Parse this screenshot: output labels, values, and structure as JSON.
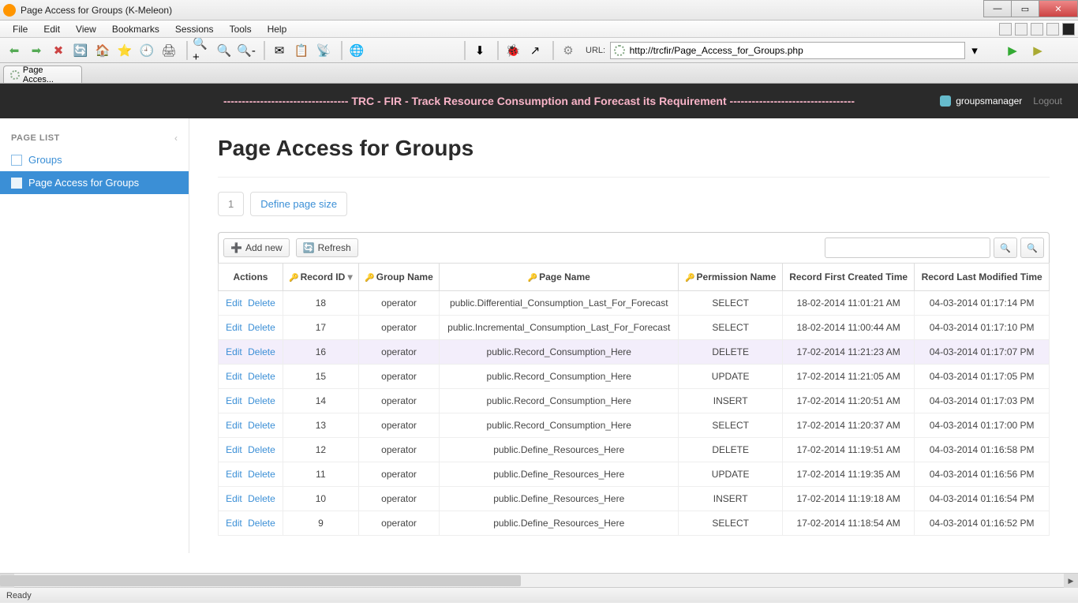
{
  "window": {
    "title": "Page Access for Groups (K-Meleon)"
  },
  "menu": [
    "File",
    "Edit",
    "View",
    "Bookmarks",
    "Sessions",
    "Tools",
    "Help"
  ],
  "url": {
    "label": "URL:",
    "value": "http://trcfir/Page_Access_for_Groups.php"
  },
  "tab": "Page Acces...",
  "banner": "---------------------------------- TRC - FIR - Track Resource Consumption and Forecast its Requirement ----------------------------------",
  "user": "groupsmanager",
  "logout": "Logout",
  "sidebar": {
    "title": "PAGE LIST",
    "items": [
      {
        "label": "Groups",
        "active": false
      },
      {
        "label": "Page Access for Groups",
        "active": true
      }
    ]
  },
  "page": {
    "title": "Page Access for Groups",
    "page_num": "1",
    "define_size": "Define page size",
    "add_new": "Add new",
    "refresh": "Refresh"
  },
  "columns": [
    "Actions",
    "Record ID",
    "Group Name",
    "Page Name",
    "Permission Name",
    "Record First Created Time",
    "Record Last Modified Time"
  ],
  "actions": {
    "edit": "Edit",
    "delete": "Delete"
  },
  "rows": [
    {
      "id": "18",
      "group": "operator",
      "page": "public.Differential_Consumption_Last_For_Forecast",
      "perm": "SELECT",
      "created": "18-02-2014 11:01:21 AM",
      "modified": "04-03-2014 01:17:14 PM"
    },
    {
      "id": "17",
      "group": "operator",
      "page": "public.Incremental_Consumption_Last_For_Forecast",
      "perm": "SELECT",
      "created": "18-02-2014 11:00:44 AM",
      "modified": "04-03-2014 01:17:10 PM"
    },
    {
      "id": "16",
      "group": "operator",
      "page": "public.Record_Consumption_Here",
      "perm": "DELETE",
      "created": "17-02-2014 11:21:23 AM",
      "modified": "04-03-2014 01:17:07 PM"
    },
    {
      "id": "15",
      "group": "operator",
      "page": "public.Record_Consumption_Here",
      "perm": "UPDATE",
      "created": "17-02-2014 11:21:05 AM",
      "modified": "04-03-2014 01:17:05 PM"
    },
    {
      "id": "14",
      "group": "operator",
      "page": "public.Record_Consumption_Here",
      "perm": "INSERT",
      "created": "17-02-2014 11:20:51 AM",
      "modified": "04-03-2014 01:17:03 PM"
    },
    {
      "id": "13",
      "group": "operator",
      "page": "public.Record_Consumption_Here",
      "perm": "SELECT",
      "created": "17-02-2014 11:20:37 AM",
      "modified": "04-03-2014 01:17:00 PM"
    },
    {
      "id": "12",
      "group": "operator",
      "page": "public.Define_Resources_Here",
      "perm": "DELETE",
      "created": "17-02-2014 11:19:51 AM",
      "modified": "04-03-2014 01:16:58 PM"
    },
    {
      "id": "11",
      "group": "operator",
      "page": "public.Define_Resources_Here",
      "perm": "UPDATE",
      "created": "17-02-2014 11:19:35 AM",
      "modified": "04-03-2014 01:16:56 PM"
    },
    {
      "id": "10",
      "group": "operator",
      "page": "public.Define_Resources_Here",
      "perm": "INSERT",
      "created": "17-02-2014 11:19:18 AM",
      "modified": "04-03-2014 01:16:54 PM"
    },
    {
      "id": "9",
      "group": "operator",
      "page": "public.Define_Resources_Here",
      "perm": "SELECT",
      "created": "17-02-2014 11:18:54 AM",
      "modified": "04-03-2014 01:16:52 PM"
    }
  ],
  "status": "Ready"
}
